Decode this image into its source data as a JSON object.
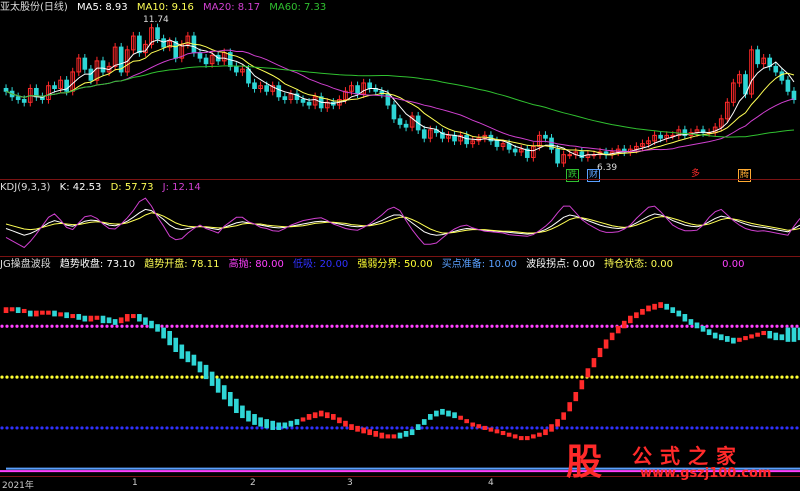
{
  "colors": {
    "up": "#ff2a2a",
    "down": "#2fd6d6",
    "ma5": "#ffffff",
    "ma10": "#ffff55",
    "ma20": "#d040d0",
    "ma60": "#30c030",
    "kdj_k": "#ffffff",
    "kdj_d": "#ffff55",
    "kdj_j": "#d040d0",
    "upper": "#ff40ff",
    "mid": "#ffff33",
    "lower": "#3030ff",
    "state": "#5aa0ff"
  },
  "panel1": {
    "title": "亚太股份(日线)",
    "ma5": "MA5: 8.93",
    "ma10": "MA10: 9.16",
    "ma20": "MA20: 8.17",
    "ma60": "MA60: 7.33",
    "high_mark": "11.74",
    "low_mark": "6.39",
    "badges": [
      "跌",
      "财",
      "多",
      "腾"
    ]
  },
  "panel2": {
    "title": "KDJ(9,3,3)",
    "k": "K: 42.53",
    "d": "D: 57.73",
    "j": "J: 12.14"
  },
  "panel3": {
    "title": "JG操盘波段",
    "close": "趋势收盘: 73.10",
    "open": "趋势开盘: 78.11",
    "high": "高抛: 80.00",
    "low": "低吸: 20.00",
    "mid": "强弱分界: 50.00",
    "buy_ready": "买点准备: 10.00",
    "pivot": "波段拐点: 0.00",
    "hold": "持仓状态: 0.00",
    "extra": "0.00"
  },
  "time_axis": [
    "2021年",
    "1",
    "2",
    "3",
    "4"
  ],
  "watermark": {
    "glyph": "股",
    "title": "公式之家",
    "url": "www.gszj100.com"
  },
  "chart_data": [
    {
      "type": "candlestick",
      "title": "亚太股份(日线)",
      "ylim": [
        6.2,
        12.0
      ],
      "close": [
        9.2,
        9.0,
        8.9,
        8.8,
        9.3,
        9.0,
        8.9,
        9.4,
        9.3,
        9.6,
        9.2,
        9.9,
        10.4,
        10.0,
        9.6,
        10.3,
        9.9,
        10.1,
        10.8,
        9.9,
        10.7,
        11.2,
        10.6,
        10.9,
        11.5,
        11.1,
        10.8,
        11.0,
        10.4,
        10.9,
        11.2,
        10.6,
        10.4,
        10.2,
        10.5,
        10.3,
        10.6,
        10.1,
        9.9,
        10.0,
        9.5,
        9.3,
        9.4,
        9.2,
        9.4,
        9.0,
        8.9,
        9.1,
        8.9,
        8.8,
        8.7,
        9.0,
        8.6,
        8.8,
        8.7,
        8.9,
        9.2,
        9.4,
        9.1,
        9.5,
        9.3,
        9.2,
        9.1,
        8.7,
        8.2,
        8.0,
        7.9,
        8.3,
        7.8,
        7.5,
        7.8,
        7.7,
        7.5,
        7.6,
        7.4,
        7.6,
        7.3,
        7.4,
        7.5,
        7.6,
        7.4,
        7.2,
        7.3,
        7.1,
        7.0,
        7.1,
        6.8,
        7.2,
        7.6,
        7.5,
        7.1,
        6.6,
        6.9,
        6.9,
        7.0,
        6.8,
        6.9,
        6.9,
        7.0,
        6.9,
        7.0,
        7.1,
        7.0,
        7.1,
        7.2,
        7.3,
        7.4,
        7.6,
        7.5,
        7.6,
        7.6,
        7.8,
        7.6,
        7.7,
        7.8,
        7.7,
        7.7,
        7.9,
        8.2,
        8.8,
        9.5,
        9.8,
        9.1,
        10.7,
        10.2,
        10.4,
        10.1,
        9.9,
        9.6,
        9.2,
        8.9
      ]
    },
    {
      "type": "line",
      "title": "KDJ(9,3,3)",
      "ylim": [
        0,
        100
      ],
      "series": [
        {
          "name": "K",
          "values": [
            42,
            38,
            34,
            30,
            33,
            38,
            45,
            52,
            56,
            53,
            48,
            46,
            50,
            55,
            57,
            56,
            52,
            48,
            47,
            50,
            55,
            62,
            70,
            76,
            74,
            66,
            58,
            48,
            42,
            40,
            42,
            44,
            46,
            44,
            42,
            40,
            44,
            48,
            52,
            54,
            52,
            50,
            48,
            46,
            44,
            43,
            44,
            46,
            48,
            50,
            52,
            54,
            55,
            54,
            52,
            50,
            48,
            46,
            45,
            46,
            48,
            52,
            56,
            62,
            66,
            66,
            60,
            52,
            44,
            36,
            32,
            30,
            31,
            34,
            37,
            40,
            42,
            41,
            40,
            39,
            38,
            37,
            36,
            35,
            34,
            33,
            32,
            33,
            36,
            40,
            46,
            54,
            62,
            66,
            64,
            60,
            56,
            52,
            48,
            45,
            43,
            42,
            43,
            46,
            52,
            58,
            64,
            68,
            66,
            62,
            56,
            52,
            48,
            46,
            45,
            48,
            54,
            60,
            64,
            62,
            58,
            54,
            50,
            47,
            45,
            44,
            42,
            40,
            38,
            36,
            42,
            48
          ]
        },
        {
          "name": "D",
          "values": [
            50,
            47,
            44,
            41,
            40,
            41,
            44,
            47,
            50,
            51,
            50,
            49,
            49,
            51,
            53,
            54,
            53,
            51,
            50,
            50,
            52,
            56,
            60,
            66,
            70,
            68,
            64,
            58,
            52,
            48,
            46,
            45,
            45,
            45,
            44,
            43,
            43,
            45,
            47,
            50,
            51,
            50,
            50,
            48,
            47,
            46,
            45,
            45,
            46,
            47,
            49,
            51,
            52,
            53,
            53,
            52,
            51,
            49,
            48,
            47,
            47,
            49,
            51,
            55,
            59,
            62,
            62,
            58,
            53,
            47,
            41,
            37,
            34,
            34,
            35,
            37,
            39,
            40,
            40,
            40,
            39,
            38,
            37,
            37,
            36,
            35,
            34,
            34,
            35,
            37,
            41,
            46,
            52,
            58,
            61,
            61,
            59,
            56,
            53,
            50,
            47,
            45,
            44,
            45,
            48,
            52,
            56,
            61,
            63,
            63,
            60,
            57,
            53,
            50,
            48,
            48,
            50,
            54,
            58,
            60,
            59,
            57,
            54,
            51,
            49,
            47,
            45,
            43,
            41,
            39,
            40,
            42
          ]
        },
        {
          "name": "J",
          "values": [
            26,
            20,
            14,
            8,
            19,
            32,
            47,
            62,
            68,
            57,
            44,
            40,
            52,
            63,
            65,
            60,
            50,
            42,
            41,
            50,
            61,
            74,
            90,
            96,
            82,
            62,
            46,
            28,
            22,
            24,
            34,
            42,
            48,
            42,
            38,
            34,
            46,
            54,
            62,
            62,
            54,
            50,
            44,
            42,
            38,
            37,
            42,
            48,
            52,
            56,
            58,
            60,
            61,
            56,
            50,
            46,
            42,
            40,
            39,
            44,
            50,
            58,
            66,
            76,
            80,
            74,
            56,
            40,
            26,
            14,
            14,
            16,
            25,
            34,
            41,
            46,
            48,
            43,
            40,
            37,
            36,
            35,
            34,
            31,
            30,
            29,
            28,
            31,
            38,
            46,
            56,
            70,
            82,
            82,
            70,
            58,
            50,
            44,
            38,
            35,
            35,
            36,
            41,
            48,
            60,
            70,
            80,
            82,
            72,
            60,
            48,
            42,
            38,
            38,
            39,
            48,
            62,
            72,
            76,
            66,
            56,
            48,
            42,
            39,
            37,
            38,
            36,
            34,
            32,
            30,
            46,
            60
          ]
        }
      ]
    },
    {
      "type": "line",
      "title": "JG操盘波段",
      "ylim": [
        -6,
        112
      ],
      "reference_lines": [
        80,
        50,
        20
      ],
      "series": [
        {
          "name": "趋势收盘",
          "values": [
            90,
            90,
            89,
            89,
            87,
            88,
            88,
            88,
            87,
            87,
            86,
            86,
            85,
            84,
            85,
            85,
            83,
            83,
            82,
            84,
            86,
            86,
            84,
            82,
            80,
            78,
            74,
            70,
            66,
            62,
            60,
            58,
            54,
            50,
            46,
            42,
            38,
            34,
            30,
            27,
            25,
            23,
            22,
            21,
            20,
            20,
            21,
            22,
            23,
            25,
            27,
            28,
            29,
            28,
            27,
            25,
            23,
            21,
            20,
            19,
            18,
            17,
            16,
            15,
            15,
            15,
            16,
            17,
            20,
            23,
            26,
            28,
            29,
            28,
            27,
            26,
            24,
            22,
            21,
            20,
            19,
            18,
            17,
            16,
            15,
            14,
            14,
            15,
            16,
            18,
            21,
            24,
            28,
            34,
            40,
            47,
            54,
            60,
            66,
            71,
            75,
            79,
            82,
            85,
            87,
            89,
            91,
            92,
            93,
            91,
            89,
            87,
            84,
            82,
            80,
            78,
            76,
            74,
            73,
            72,
            71,
            72,
            73,
            74,
            75,
            76,
            74,
            73,
            73,
            72,
            72,
            73
          ]
        },
        {
          "name": "趋势开盘",
          "values": [
            89,
            90,
            90,
            89,
            88,
            87,
            88,
            88,
            88,
            87,
            87,
            86,
            86,
            85,
            84,
            85,
            85,
            84,
            83,
            83,
            84,
            86,
            86,
            84,
            82,
            80,
            78,
            76,
            72,
            68,
            64,
            62,
            58,
            56,
            52,
            48,
            44,
            40,
            36,
            32,
            29,
            27,
            25,
            24,
            23,
            22,
            22,
            23,
            24,
            25,
            26,
            27,
            28,
            27,
            26,
            24,
            22,
            20,
            19,
            18,
            17,
            16,
            15,
            15,
            15,
            16,
            17,
            18,
            21,
            24,
            27,
            29,
            30,
            29,
            28,
            26,
            24,
            22,
            21,
            20,
            19,
            18,
            17,
            16,
            15,
            14,
            14,
            15,
            16,
            17,
            19,
            22,
            26,
            31,
            37,
            44,
            51,
            57,
            63,
            68,
            73,
            77,
            80,
            83,
            86,
            88,
            90,
            91,
            92,
            92,
            90,
            88,
            86,
            83,
            81,
            79,
            77,
            75,
            74,
            73,
            72,
            72,
            73,
            74,
            75,
            76,
            76,
            75,
            74,
            78,
            78,
            78
          ]
        },
        {
          "name": "持仓状态",
          "values": [
            0,
            0,
            0,
            0,
            0,
            0,
            0,
            0,
            0,
            0,
            0,
            0,
            0,
            0,
            0,
            0,
            0,
            0,
            0,
            0,
            0,
            0,
            0,
            0,
            0,
            0,
            0,
            0,
            0,
            0,
            0,
            0,
            0,
            0,
            0,
            0,
            0,
            0,
            0,
            0,
            0,
            0,
            0,
            0,
            0,
            0,
            0,
            0,
            0,
            0,
            0,
            0,
            0,
            0,
            0,
            0,
            0,
            0,
            0,
            0,
            0,
            0,
            0,
            0,
            0,
            0,
            0,
            0,
            0,
            0,
            0,
            0,
            0,
            0,
            0,
            0,
            0,
            0,
            0,
            0,
            0,
            0,
            0,
            0,
            0,
            0,
            0,
            0,
            0,
            0,
            0,
            0,
            0,
            0,
            0,
            0,
            0,
            0,
            0,
            0,
            0,
            0,
            0,
            0,
            0,
            0,
            0,
            0,
            0,
            0,
            0,
            0,
            0,
            0,
            0,
            0,
            0,
            0,
            0,
            0,
            0,
            0,
            0,
            0,
            0,
            0,
            0,
            0,
            0,
            0,
            0,
            0
          ]
        }
      ]
    }
  ]
}
